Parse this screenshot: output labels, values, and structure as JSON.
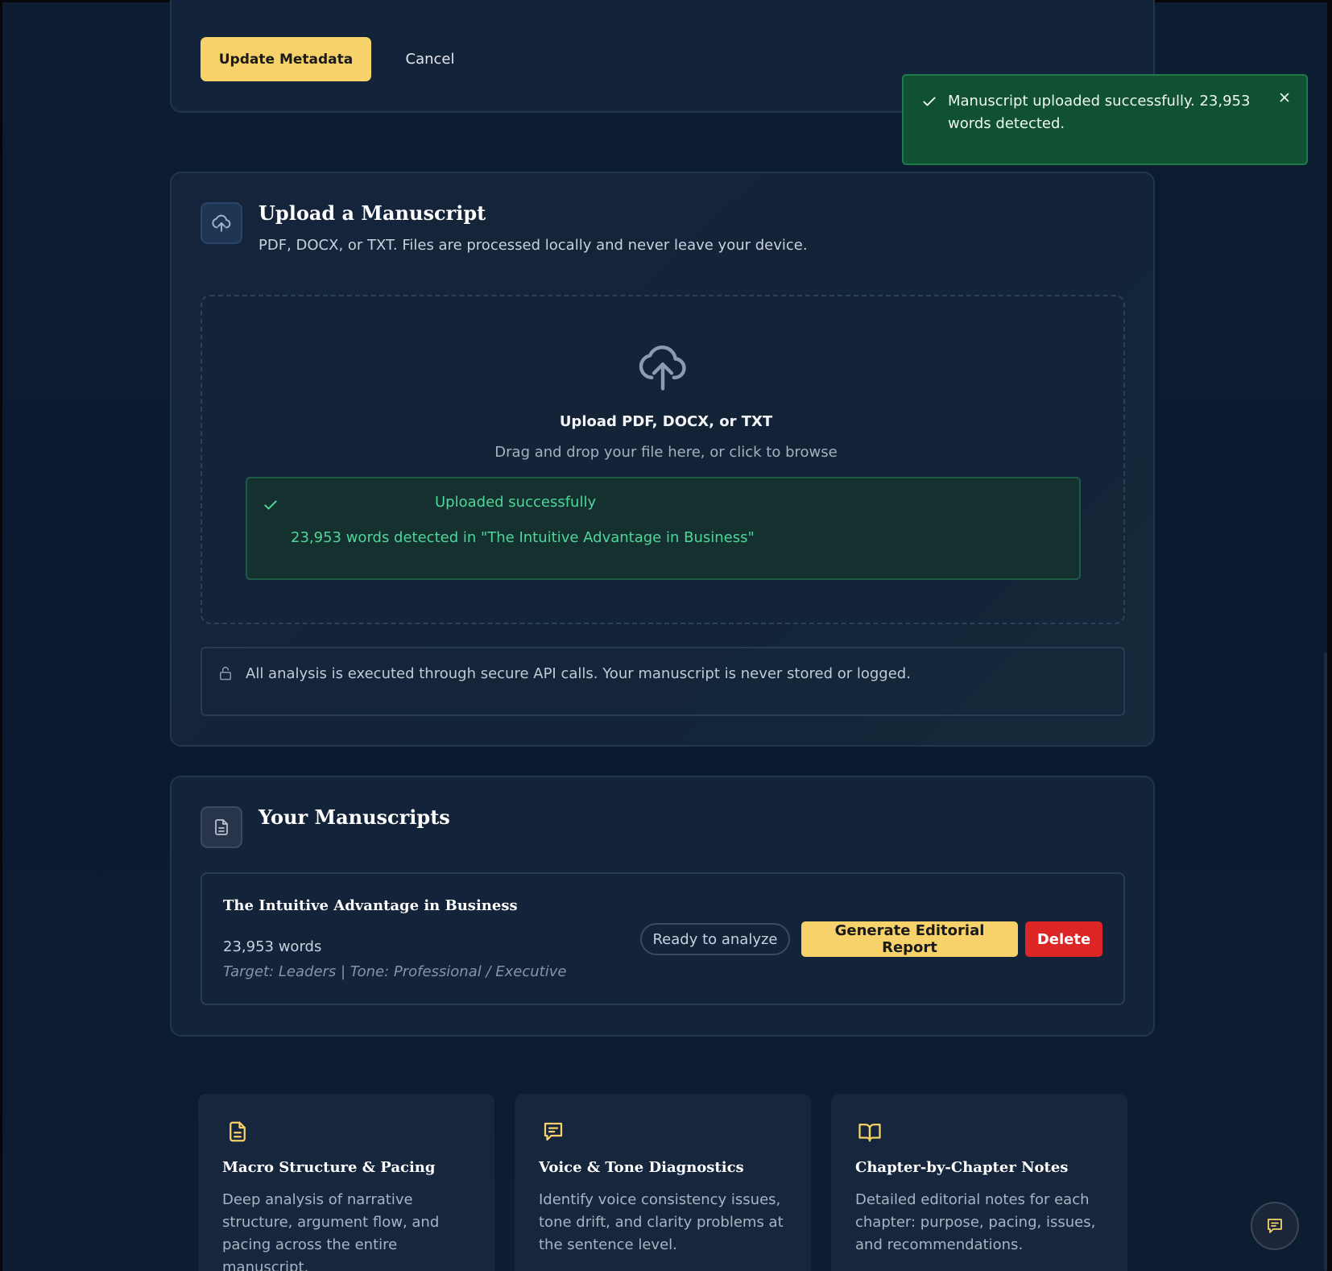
{
  "metadata_form": {
    "update_label": "Update Metadata",
    "cancel_label": "Cancel"
  },
  "toast": {
    "message": "Manuscript uploaded successfully. 23,953 words detected.",
    "status_color": "#0f5131"
  },
  "upload_section": {
    "title": "Upload a Manuscript",
    "subtitle": "PDF, DOCX, or TXT. Files are processed locally and never leave your device.",
    "dropzone_title": "Upload PDF, DOCX, or TXT",
    "dropzone_subtitle": "Drag and drop your file here, or click to browse",
    "success_title": "Uploaded successfully",
    "success_detail": "23,953 words detected in \"The Intuitive Advantage in Business\"",
    "security_note": "All analysis is executed through secure API calls. Your manuscript is never stored or logged."
  },
  "manuscripts_section": {
    "title": "Your Manuscripts",
    "items": [
      {
        "title": "The Intuitive Advantage in Business",
        "words": "23,953 words",
        "meta": "Target: Leaders | Tone: Professional / Executive",
        "status": "Ready to analyze",
        "generate_label": "Generate Editorial Report",
        "delete_label": "Delete"
      }
    ]
  },
  "features": [
    {
      "icon": "document-icon",
      "title": "Macro Structure & Pacing",
      "description": "Deep analysis of narrative structure, argument flow, and pacing across the entire manuscript."
    },
    {
      "icon": "message-icon",
      "title": "Voice & Tone Diagnostics",
      "description": "Identify voice consistency issues, tone drift, and clarity problems at the sentence level."
    },
    {
      "icon": "book-icon",
      "title": "Chapter-by-Chapter Notes",
      "description": "Detailed editorial notes for each chapter: purpose, pacing, issues, and recommendations."
    }
  ],
  "colors": {
    "accent": "#f7d26a",
    "danger": "#dc2626",
    "success_text": "#4fd59a",
    "background": "#0b1a2e"
  }
}
